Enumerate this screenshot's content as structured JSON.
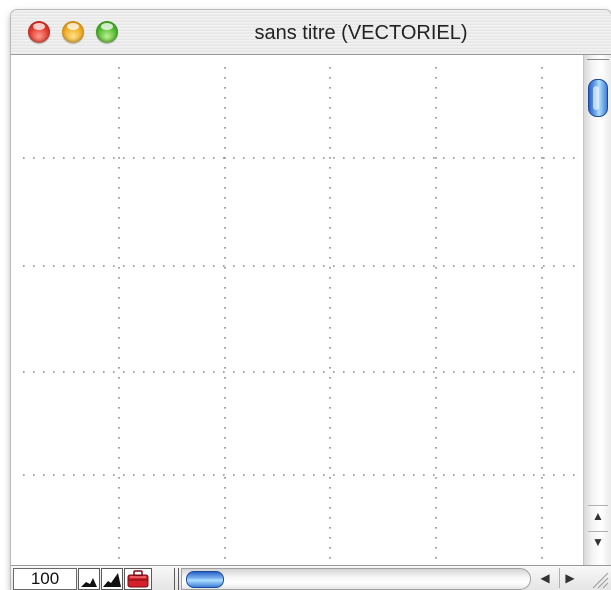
{
  "window": {
    "title": "sans titre (VECTORIEL)"
  },
  "titlebar_buttons": {
    "close": "close-button",
    "minimize": "minimize-button",
    "zoom": "zoom-button"
  },
  "canvas": {
    "grid": "dotted"
  },
  "statusbar": {
    "zoom_value": "100",
    "tools": [
      "mountain-small-icon",
      "mountain-large-icon",
      "toolbox-icon"
    ]
  },
  "scrollbars": {
    "vertical": "vertical-scrollbar",
    "horizontal": "horizontal-scrollbar",
    "up_arrow": "▲",
    "down_arrow": "▼",
    "left_arrow": "◀",
    "right_arrow": "▶"
  },
  "colors": {
    "close": "#e0362a",
    "minimize": "#f0a81c",
    "zoom": "#4cb52c",
    "thumb": "#3f7fd8",
    "toolbox": "#d4202a"
  }
}
